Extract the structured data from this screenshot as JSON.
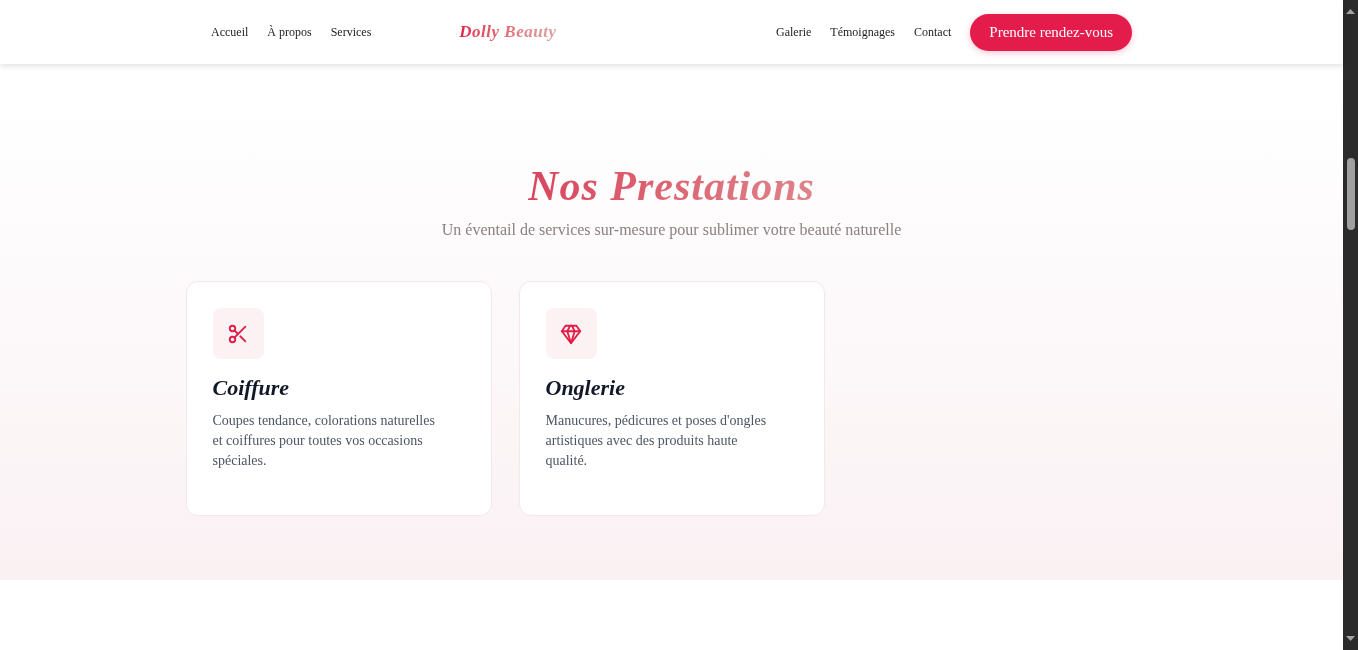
{
  "header": {
    "nav_left": [
      {
        "label": "Accueil"
      },
      {
        "label": "À propos"
      },
      {
        "label": "Services"
      }
    ],
    "logo": "Dolly Beauty",
    "nav_right": [
      {
        "label": "Galerie"
      },
      {
        "label": "Témoignages"
      },
      {
        "label": "Contact"
      }
    ],
    "cta": "Prendre rendez-vous"
  },
  "services": {
    "title": "Nos Prestations",
    "subtitle": "Un éventail de services sur-mesure pour sublimer votre beauté naturelle",
    "cards": [
      {
        "kind": "hair",
        "title": "Coiffure",
        "description": "Coupes tendance, colorations naturelles et coiffures pour toutes vos occasions spéciales."
      },
      {
        "kind": "nails",
        "title": "Onglerie",
        "description": "Manucures, pédicures et poses d'ongles artistiques avec des produits haute qualité."
      }
    ]
  }
}
